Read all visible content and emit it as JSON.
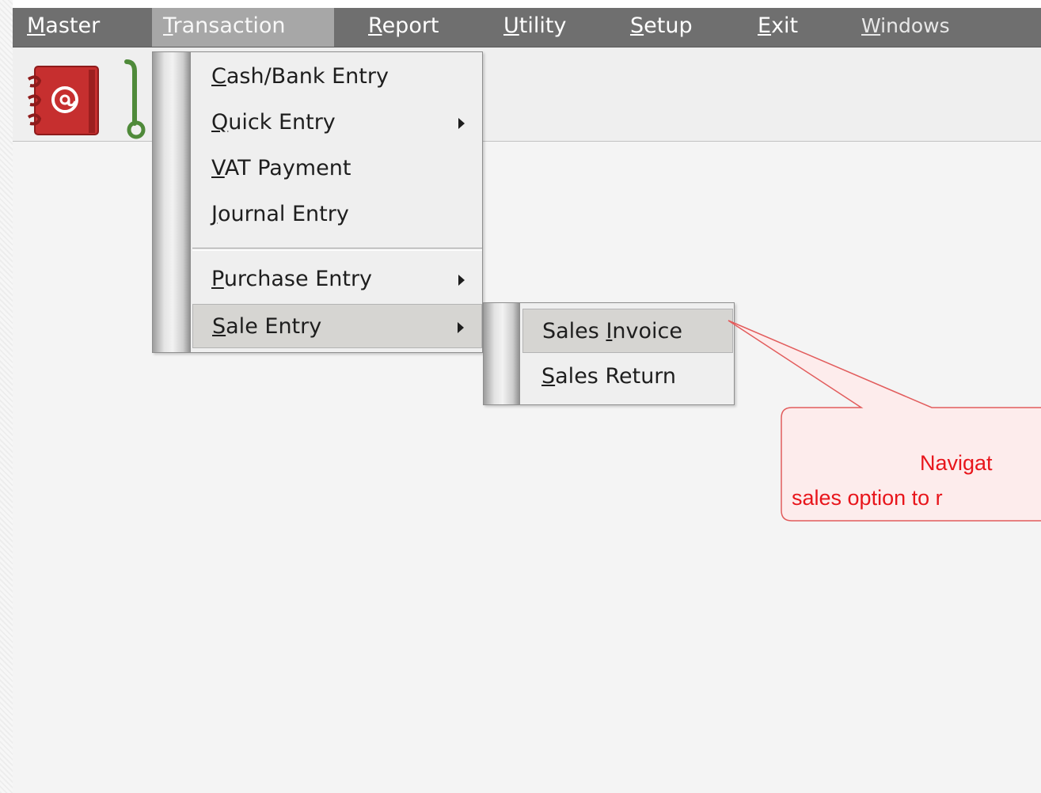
{
  "menubar": {
    "items": [
      {
        "label": "Master",
        "mnemonic": "M",
        "rest": "aster"
      },
      {
        "label": "Transaction",
        "mnemonic": "T",
        "rest": "ransaction"
      },
      {
        "label": "Report",
        "mnemonic": "R",
        "rest": "eport"
      },
      {
        "label": "Utility",
        "mnemonic": "U",
        "rest": "tility"
      },
      {
        "label": "Setup",
        "mnemonic": "S",
        "rest": "etup"
      },
      {
        "label": "Exit",
        "mnemonic": "E",
        "rest": "xit"
      },
      {
        "label": "Windows",
        "mnemonic": "W",
        "rest": "indows"
      }
    ],
    "active": "Transaction"
  },
  "toolbar": {
    "icons": [
      "address-book-icon",
      "hand-truck-icon"
    ]
  },
  "transaction_menu": {
    "items": [
      {
        "label": "Cash/Bank Entry",
        "mnemonic": "C",
        "rest": "ash/Bank Entry",
        "submenu": false
      },
      {
        "label": "Quick Entry",
        "mnemonic": "Q",
        "rest": "uick Entry",
        "submenu": true
      },
      {
        "label": "VAT Payment",
        "mnemonic": "V",
        "rest": "AT Payment",
        "submenu": false
      },
      {
        "label": "Journal Entry",
        "mnemonic": "J",
        "rest": "ournal Entry",
        "submenu": false
      },
      {
        "label": "Purchase Entry",
        "mnemonic": "P",
        "rest": "urchase Entry",
        "submenu": true
      },
      {
        "label": "Sale Entry",
        "mnemonic": "S",
        "rest": "ale Entry",
        "submenu": true
      }
    ],
    "highlighted": "Sale Entry"
  },
  "sale_submenu": {
    "items": [
      {
        "label": "Sales Invoice",
        "pre": "Sales ",
        "mnemonic": "I",
        "rest": "nvoice"
      },
      {
        "label": "Sales Return",
        "pre": "",
        "mnemonic": "S",
        "rest": "ales Return"
      }
    ],
    "highlighted": "Sales Invoice"
  },
  "callout": {
    "line1": "Navigat",
    "line2": "sales option to r",
    "color": "#e8151b"
  }
}
